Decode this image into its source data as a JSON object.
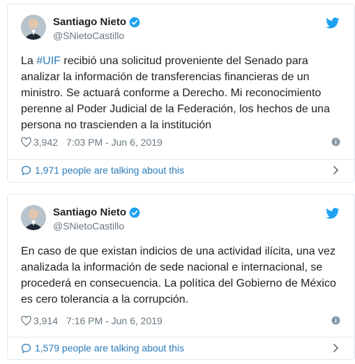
{
  "colors": {
    "link": "#2b7bb9",
    "text": "#1c2022",
    "muted": "#697882",
    "twitter_blue": "#1da1f2",
    "border": "#e1e8ed"
  },
  "tweets": [
    {
      "author_name": "Santiago Nieto",
      "handle": "@SNietoCastillo",
      "text_prefix": "La ",
      "hashtag": "#UIF",
      "text_rest": " recibió una solicitud proveniente del Senado para analizar la información de transferencias financieras de un ministro. Se actuará conforme a Derecho. Mi reconocimiento perenne al Poder Judicial de la Federación, los hechos de una persona no trascienden a la institución",
      "likes": "3,942",
      "timestamp": "7:03 PM - Jun 6, 2019",
      "talking": "1,971 people are talking about this"
    },
    {
      "author_name": "Santiago Nieto",
      "handle": "@SNietoCastillo",
      "text": "En caso de que existan indicios de una actividad ilícita, una vez analizada la información de sede nacional e internacional, se procederá en consecuencia. La política del Gobierno de México es cero tolerancia a la corrupción.",
      "likes": "3,914",
      "timestamp": "7:16 PM - Jun 6, 2019",
      "talking": "1,579 people are talking about this"
    }
  ],
  "icons": [
    "verified-badge-icon",
    "twitter-bird-icon",
    "heart-icon",
    "info-icon",
    "comment-bubble-icon",
    "chevron-right-icon"
  ]
}
